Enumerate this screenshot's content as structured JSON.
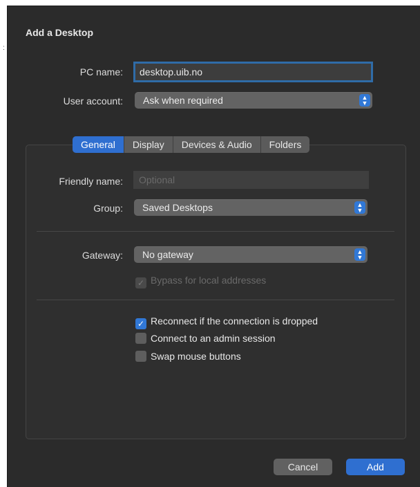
{
  "dialog": {
    "title": "Add a Desktop"
  },
  "pc_name": {
    "label": "PC name:",
    "value": "desktop.uib.no"
  },
  "user_account": {
    "label": "User account:",
    "value": "Ask when required"
  },
  "tabs": [
    {
      "label": "General",
      "active": true
    },
    {
      "label": "Display",
      "active": false
    },
    {
      "label": "Devices & Audio",
      "active": false
    },
    {
      "label": "Folders",
      "active": false
    }
  ],
  "general": {
    "friendly_name": {
      "label": "Friendly name:",
      "value": "",
      "placeholder": "Optional"
    },
    "group": {
      "label": "Group:",
      "value": "Saved Desktops"
    },
    "gateway": {
      "label": "Gateway:",
      "value": "No gateway"
    },
    "bypass": {
      "label": "Bypass for local addresses",
      "checked": true,
      "enabled": false
    },
    "reconnect": {
      "label": "Reconnect if the connection is dropped",
      "checked": true
    },
    "admin_session": {
      "label": "Connect to an admin session",
      "checked": false
    },
    "swap_mouse": {
      "label": "Swap mouse buttons",
      "checked": false
    }
  },
  "buttons": {
    "cancel": "Cancel",
    "add": "Add"
  },
  "colors": {
    "background": "#2b2b2b",
    "accent": "#2f6fd0",
    "popup": "#636363"
  }
}
